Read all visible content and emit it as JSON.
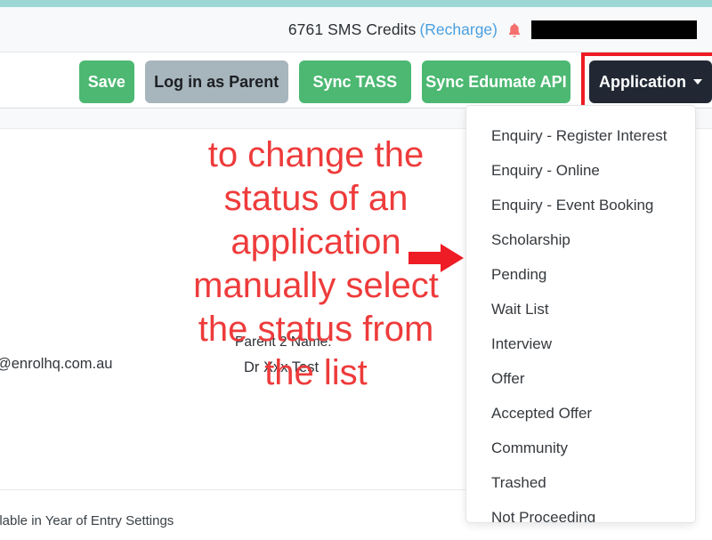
{
  "header": {
    "credits_text": "6761 SMS Credits",
    "recharge_label": "(Recharge)",
    "bell_icon": "bell-icon",
    "redacted_field": ""
  },
  "toolbar": {
    "save_label": "Save",
    "login_parent_label": "Log in as Parent",
    "sync_tass_label": "Sync TASS",
    "sync_edumate_label": "Sync Edumate API",
    "application_label": "Application",
    "caret_icon": "chevron-down-icon"
  },
  "dropdown": {
    "items": [
      {
        "label": "Enquiry - Register Interest"
      },
      {
        "label": "Enquiry - Online"
      },
      {
        "label": "Enquiry - Event Booking"
      },
      {
        "label": "Scholarship"
      },
      {
        "label": "Pending"
      },
      {
        "label": "Wait List"
      },
      {
        "label": "Interview"
      },
      {
        "label": "Offer"
      },
      {
        "label": "Accepted Offer"
      },
      {
        "label": "Community"
      },
      {
        "label": "Trashed"
      },
      {
        "label": "Not Proceeding"
      }
    ]
  },
  "form": {
    "clipped_label": ":",
    "clipped_email": "@enrolhq.com.au",
    "parent2_label": "Parent 2 Name:",
    "parent2_value": "Dr Xxx Test",
    "settings_note": "ilable in Year of Entry Settings"
  },
  "annotation": {
    "line1": "to change the",
    "line2": "status of an",
    "line3": "application",
    "line4": "manually select",
    "line5": "the status from",
    "line6": "the list",
    "arrow_icon": "right-arrow-icon",
    "color": "#ee3b3b"
  },
  "highlight": {
    "color": "#ee1c25"
  }
}
